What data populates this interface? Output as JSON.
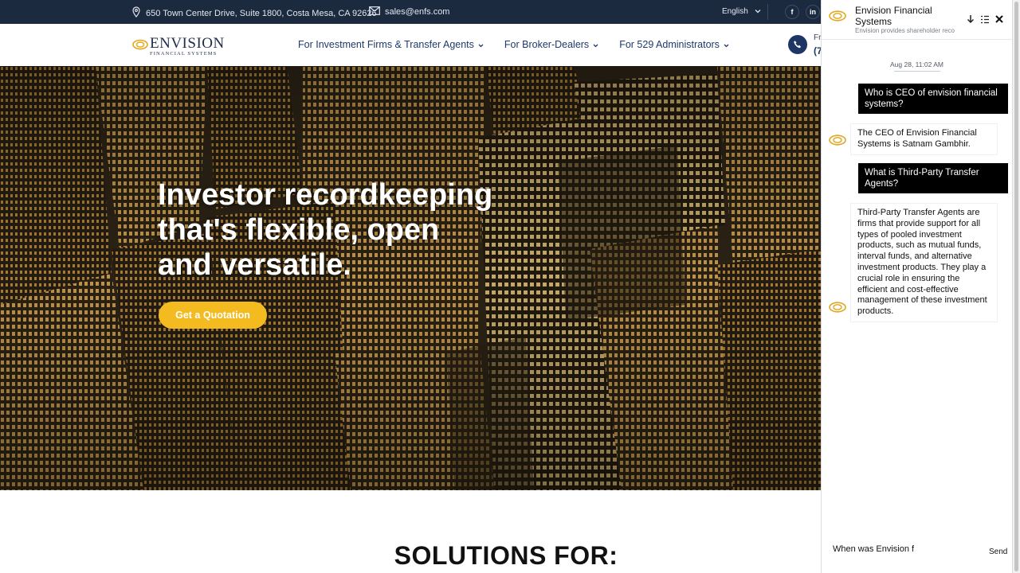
{
  "topbar": {
    "address": "650 Town Center Drive, Suite 1800, Costa Mesa, CA 92626",
    "email": "sales@enfs.com",
    "language": "English",
    "social": [
      "f",
      "in"
    ]
  },
  "header": {
    "logo_main": "ENVISION",
    "logo_sub": "Financial Systems",
    "nav": [
      {
        "label": "For Investment Firms & Transfer Agents"
      },
      {
        "label": "For Broker-Dealers"
      },
      {
        "label": "For 529 Administrators"
      }
    ],
    "phone_label": "Fr",
    "phone_number": "(7"
  },
  "hero": {
    "title": "Investor recordkeeping that's flexible, open and versatile.",
    "button": "Get a Quotation"
  },
  "solutions_heading": "SOLUTIONS FOR:",
  "chat": {
    "title": "Envision Financial Systems",
    "subtitle": "Envision provides shareholder reco",
    "timestamp": "Aug 28, 11:02 AM",
    "messages": [
      {
        "role": "user",
        "text": "Who is CEO of envision financial systems?"
      },
      {
        "role": "bot",
        "text": "The CEO of Envision Financial Systems is Satnam Gambhir."
      },
      {
        "role": "user",
        "text": "What is Third-Party Transfer Agents?"
      },
      {
        "role": "bot",
        "text": "Third-Party Transfer Agents are firms that provide support for all types of pooled investment products, such as mutual funds, interval funds, and alternative investment products. They play a crucial role in ensuring the efficient and cost-effective management of these investment products."
      }
    ],
    "input_value": "When was Envision f",
    "send_label": "Send"
  },
  "colors": {
    "topbar_bg": "#1c2a3f",
    "nav_text": "#1d3a6b",
    "accent_gold": "#f3bb1f",
    "logo_gold": "#e0a81e",
    "chat_user_bubble": "#000000"
  }
}
